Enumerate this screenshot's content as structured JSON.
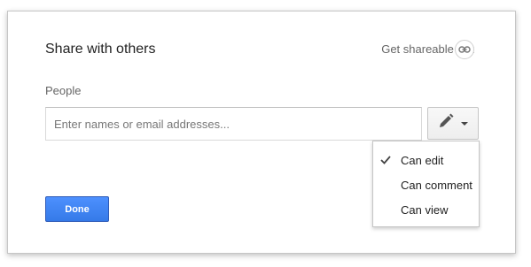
{
  "dialog": {
    "title": "Share with others",
    "shareable_link_label": "Get shareable link",
    "shareable_link_icon": "link-icon",
    "people_label": "People",
    "people_input": {
      "placeholder": "Enter names or email addresses...",
      "value": ""
    },
    "permission_button": {
      "icon": "pencil-icon",
      "dropdown_icon": "caret-down-icon"
    },
    "permission_menu": {
      "selected": "Can edit",
      "items": [
        {
          "label": "Can edit",
          "checked": true
        },
        {
          "label": "Can comment",
          "checked": false
        },
        {
          "label": "Can view",
          "checked": false
        }
      ]
    },
    "done_label": "Done"
  },
  "colors": {
    "primary_button": "#4d90fe",
    "border": "#c6c6c6",
    "text": "#222222",
    "muted_text": "#666666"
  }
}
